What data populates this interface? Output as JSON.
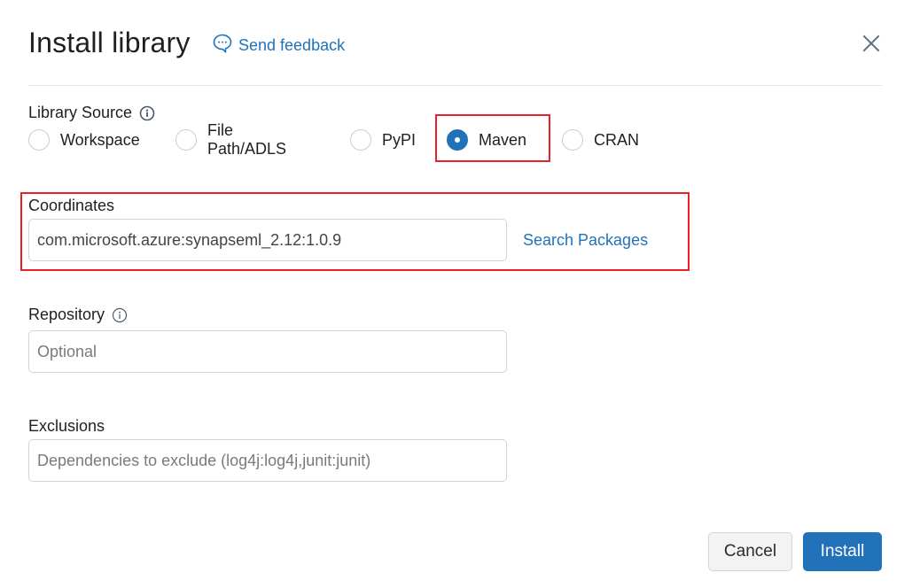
{
  "dialog": {
    "title": "Install library",
    "feedback_label": "Send feedback",
    "close_icon": "close-icon"
  },
  "library_source": {
    "label": "Library Source",
    "info_icon": "info-icon",
    "options": [
      {
        "label": "Workspace",
        "checked": false
      },
      {
        "label": "File Path/ADLS",
        "checked": false
      },
      {
        "label": "PyPI",
        "checked": false
      },
      {
        "label": "Maven",
        "checked": true
      },
      {
        "label": "CRAN",
        "checked": false
      }
    ],
    "selected": "Maven"
  },
  "coordinates": {
    "label": "Coordinates",
    "value": "com.microsoft.azure:synapseml_2.12:1.0.9",
    "search_link": "Search Packages"
  },
  "repository": {
    "label": "Repository",
    "info_icon": "info-icon",
    "value": "",
    "placeholder": "Optional"
  },
  "exclusions": {
    "label": "Exclusions",
    "value": "",
    "placeholder": "Dependencies to exclude (log4j:log4j,junit:junit)"
  },
  "footer": {
    "cancel_label": "Cancel",
    "install_label": "Install"
  },
  "colors": {
    "accent": "#2272b9",
    "highlight": "#e8202a"
  }
}
